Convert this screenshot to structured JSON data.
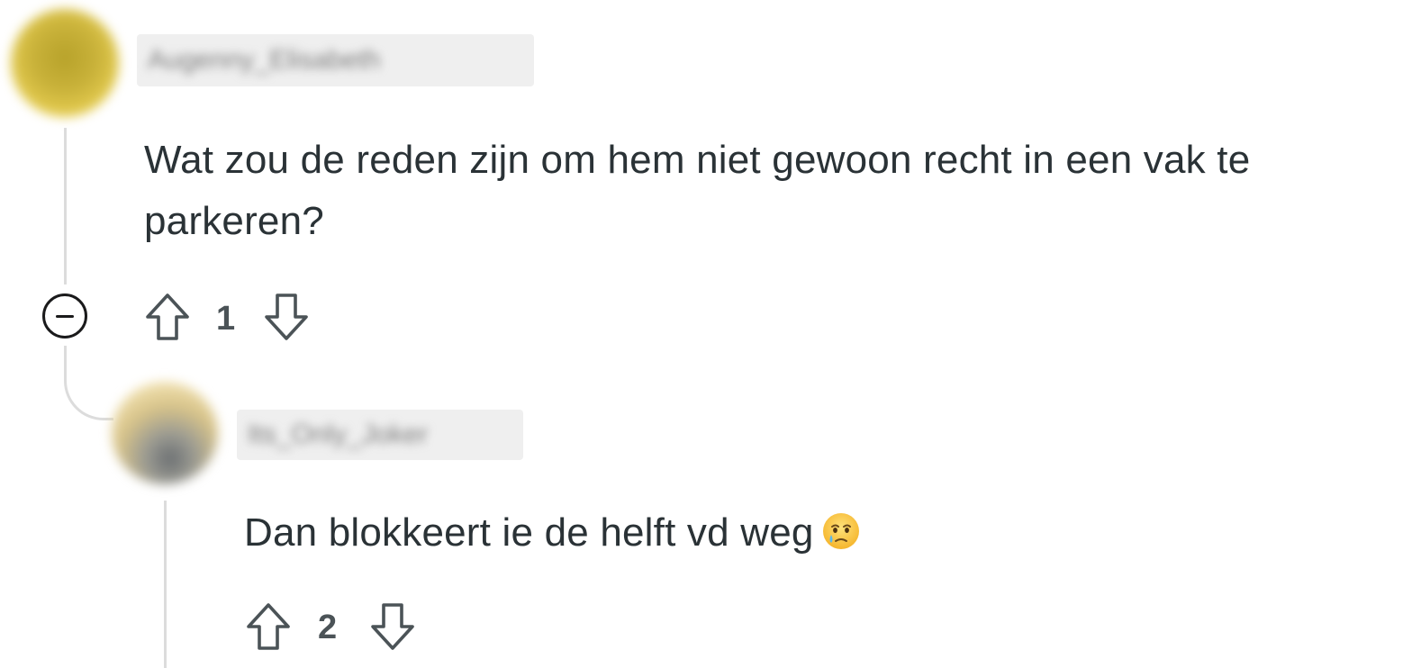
{
  "comments": [
    {
      "author": "Augenny_Elisabeth",
      "body": "Wat zou de reden zijn om hem niet gewoon recht in een vak te parkeren?",
      "votes": "1",
      "collapse_icon": "minus-circle-icon"
    },
    {
      "author": "Its_Only_Joker",
      "body": "Dan blokkeert ie de helft vd weg",
      "votes": "2",
      "emoji": "face-holding-back-tears"
    }
  ],
  "icons": {
    "upvote": "arrow-up-outline-icon",
    "downvote": "arrow-down-outline-icon"
  },
  "colors": {
    "text": "#2a3236",
    "vote_count": "#4b5357",
    "thread_line": "#dcdcdc",
    "icon_stroke": "#4b5357"
  }
}
